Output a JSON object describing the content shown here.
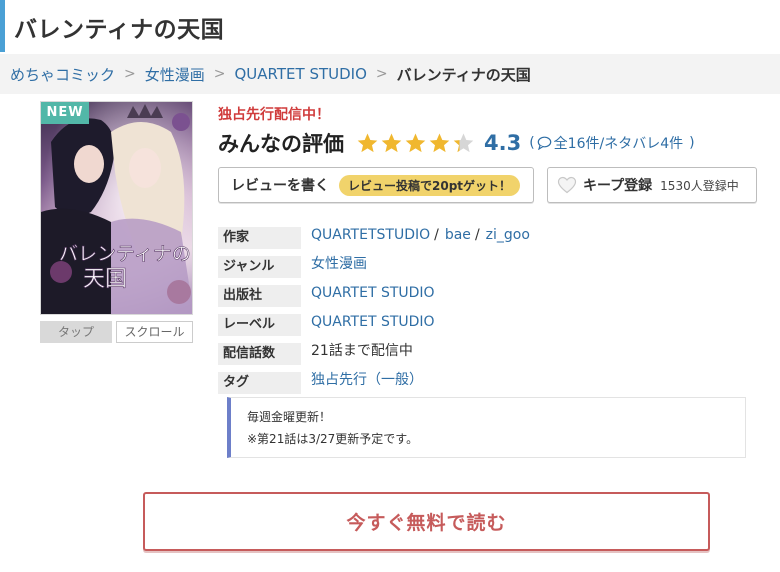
{
  "page": {
    "title": "バレンティナの天国",
    "accent_color": "#4aa0d5"
  },
  "breadcrumb": {
    "items": [
      "めちゃコミック",
      "女性漫画",
      "QUARTET STUDIO"
    ],
    "separator": ">",
    "current": "バレンティナの天国"
  },
  "cover": {
    "badge": "NEW",
    "artwork_title": "バレンティナの天国",
    "tap_label": "タップ",
    "scroll_label": "スクロール"
  },
  "status": {
    "exclusive": "独占先行配信中！"
  },
  "rating": {
    "label": "みんなの評価",
    "score": "4.3",
    "score_value": 4.3,
    "max": 5,
    "open_paren": "(",
    "close_paren": ")",
    "count_text": "全16件/ネタバレ4件",
    "star_color": "#f0b72f",
    "icon": "speech-bubble-icon"
  },
  "actions": {
    "review_label": "レビューを書く",
    "review_badge": "レビュー投稿で20ptゲット！",
    "keep_label": "キープ登録",
    "keep_count": "1530人登録中",
    "keep_icon": "heart-icon"
  },
  "info": {
    "author_key": "作家",
    "authors": [
      "QUARTETSTUDIO",
      "bae",
      "zi_goo"
    ],
    "author_sep": "/",
    "genre_key": "ジャンル",
    "genre": "女性漫画",
    "publisher_key": "出版社",
    "publisher": "QUARTET STUDIO",
    "label_key": "レーベル",
    "label": "QUARTET STUDIO",
    "episodes_key": "配信話数",
    "episodes": "21話まで配信中",
    "tag_key": "タグ",
    "tag": "独占先行（一般）"
  },
  "notice": {
    "line1": "毎週金曜更新！",
    "line2": "※第21話は3/27更新予定です。",
    "border_color": "#6d7fc9"
  },
  "cta": {
    "label": "今すぐ無料で読む",
    "color": "#c65b5b"
  }
}
